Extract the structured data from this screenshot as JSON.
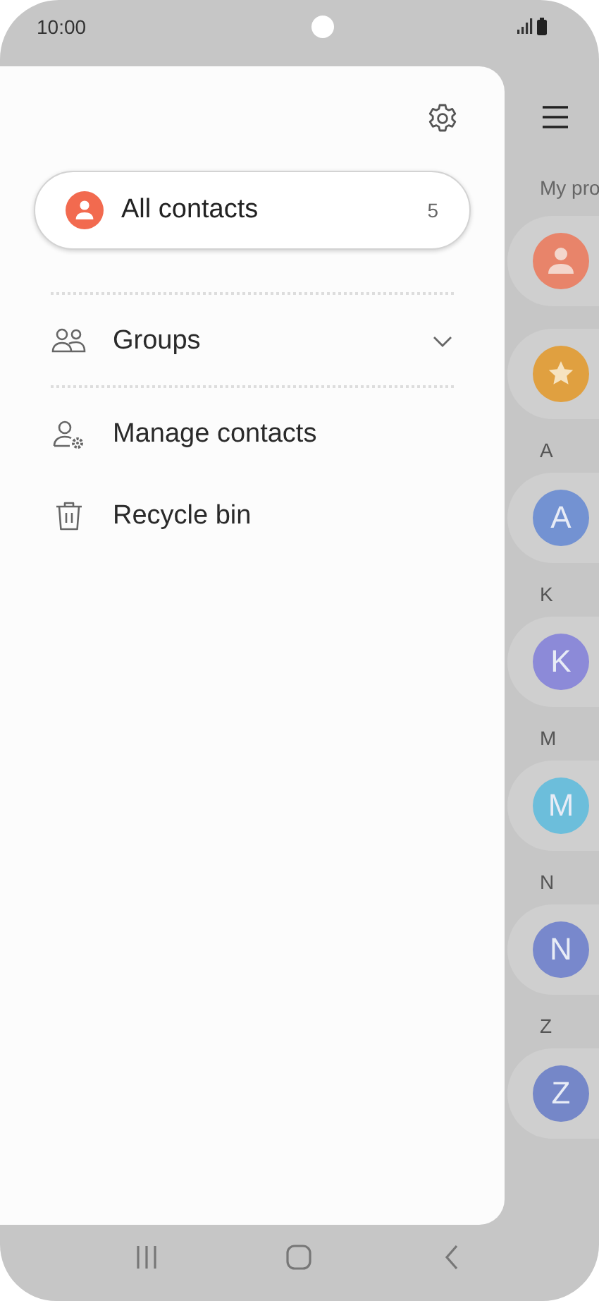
{
  "status_bar": {
    "time": "10:00"
  },
  "drawer": {
    "all_contacts": {
      "label": "All contacts",
      "count": "5",
      "selected": true
    },
    "items": [
      {
        "kind": "groups",
        "label": "Groups",
        "expanded": false
      },
      {
        "kind": "manage",
        "label": "Manage contacts"
      },
      {
        "kind": "bin",
        "label": "Recycle bin"
      }
    ]
  },
  "contacts_list": {
    "section_label": "My pro",
    "rows": [
      {
        "kind": "profile",
        "color": "#e8846a"
      },
      {
        "kind": "favorites",
        "color": "#e0a040"
      },
      {
        "kind": "contact",
        "header": "A",
        "initial": "A",
        "color": "#7392d2"
      },
      {
        "kind": "contact",
        "header": "K",
        "initial": "K",
        "color": "#8c8ad8"
      },
      {
        "kind": "contact",
        "header": "M",
        "initial": "M",
        "color": "#6cbedb"
      },
      {
        "kind": "contact",
        "header": "N",
        "initial": "N",
        "color": "#7888cc"
      },
      {
        "kind": "contact",
        "header": "Z",
        "initial": "Z",
        "color": "#7587c8"
      }
    ]
  }
}
